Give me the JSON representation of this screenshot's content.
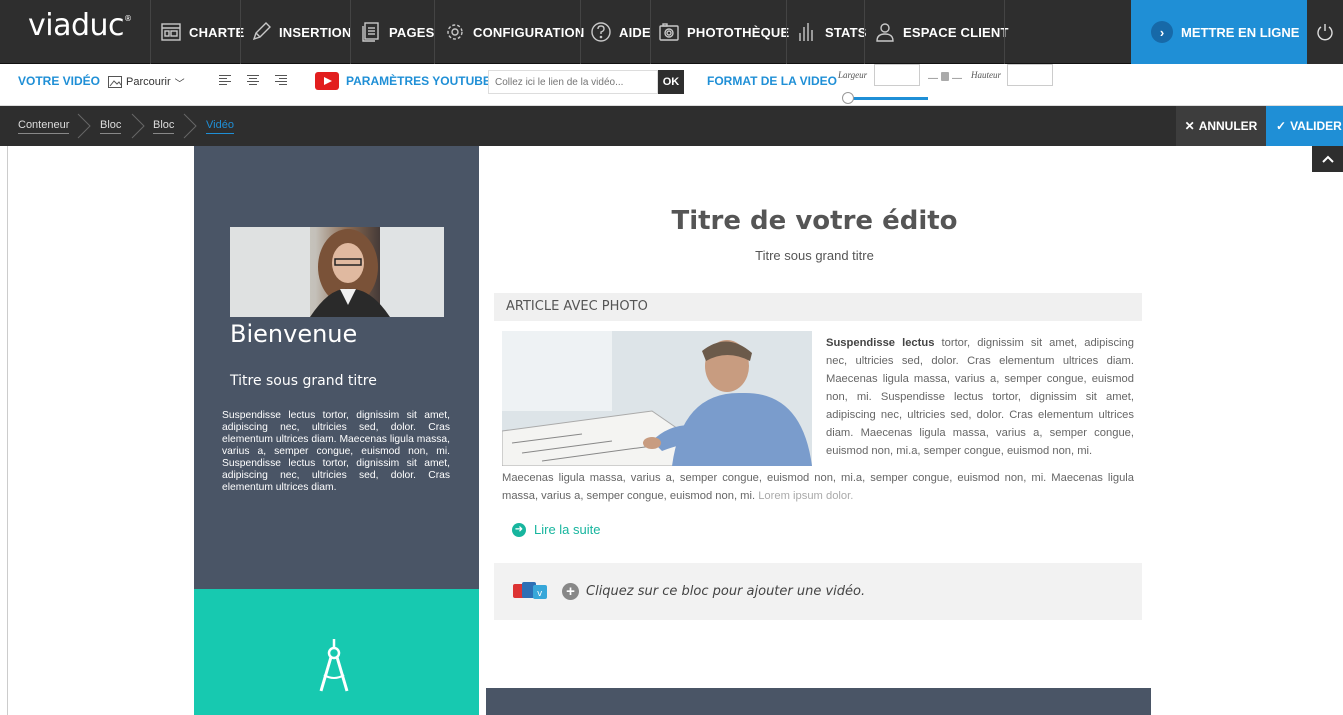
{
  "app": {
    "logo": "viaduc",
    "logo_mark": "®"
  },
  "nav": {
    "items": [
      {
        "label": "CHARTE",
        "icon": "palette-icon"
      },
      {
        "label": "INSERTION",
        "icon": "pencil-icon"
      },
      {
        "label": "PAGES",
        "icon": "pages-icon"
      },
      {
        "label": "CONFIGURATION",
        "icon": "gear-icon"
      },
      {
        "label": "AIDE",
        "icon": "help-icon"
      },
      {
        "label": "PHOTOTHÈQUE",
        "icon": "camera-icon"
      },
      {
        "label": "STATS",
        "icon": "stats-icon"
      },
      {
        "label": "ESPACE CLIENT",
        "icon": "user-icon"
      }
    ],
    "publish_label": "METTRE EN LIGNE",
    "accent": "#1f8fd6"
  },
  "toolbar": {
    "video_label": "VOTRE VIDÉO",
    "browse_label": "Parcourir",
    "youtube_label": "PARAMÈTRES YOUTUBE",
    "url_placeholder": "Collez ici le lien de la vidéo...",
    "ok_label": "OK",
    "format_label": "FORMAT DE LA VIDEO",
    "width_label": "Largeur",
    "height_label": "Hauteur",
    "width_value": "",
    "height_value": ""
  },
  "breadcrumb": [
    "Conteneur",
    "Bloc",
    "Bloc",
    "Vidéo"
  ],
  "actions": {
    "cancel": "ANNULER",
    "validate": "VALIDER"
  },
  "sidebar": {
    "heading": "Bienvenue",
    "subheading": "Titre sous grand titre",
    "body": "Suspendisse lectus tortor, dignissim sit amet, adipiscing nec, ultricies sed, dolor. Cras elementum ultrices diam. Maecenas ligula massa, varius a, semper congue, euismod non, mi. Suspendisse lectus tortor, dignissim sit amet, adipiscing nec, ultricies sed, dolor. Cras elementum ultrices diam.",
    "bg_color": "#4a5566",
    "teal_color": "#17c9b0"
  },
  "main": {
    "title": "Titre de votre édito",
    "subtitle": "Titre sous grand titre",
    "article_heading": "ARTICLE AVEC PHOTO",
    "article_bold": "Suspendisse lectus",
    "article_body": " tortor, dignissim sit amet, adipiscing nec, ultricies sed, dolor. Cras elementum ultrices diam. Maecenas ligula massa, varius a, semper congue, euismod non, mi. Suspendisse lectus tortor, dignissim sit amet, adipiscing nec, ultricies sed, dolor. Cras elementum ultrices diam. Maecenas ligula massa, varius a, semper congue, euismod non, mi.a, semper congue, euismod non, mi.",
    "article_body2": "Maecenas ligula massa, varius a, semper congue, euismod non, mi.a, semper congue, euismod non, mi. Maecenas ligula massa, varius a, semper congue, euismod non, mi.",
    "article_muted": " Lorem ipsum dolor.",
    "read_more": "Lire la suite",
    "video_prompt": "Cliquez sur ce bloc pour ajouter une vidéo."
  }
}
